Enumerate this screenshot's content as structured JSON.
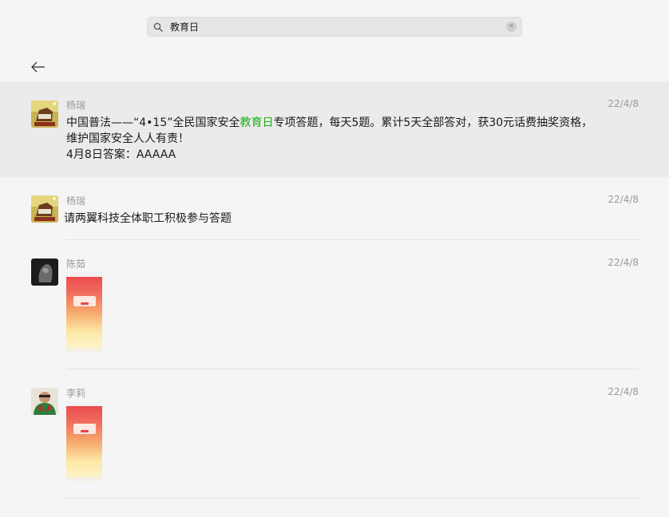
{
  "search": {
    "value": "教育日",
    "icon": "search-icon",
    "clear_icon": "clear-icon"
  },
  "nav": {
    "back_icon": "arrow-left-icon"
  },
  "colors": {
    "highlight": "#1aad19",
    "selected_row": "#ebebeb",
    "background": "#f5f5f5"
  },
  "results": [
    {
      "sender": "杨瑞",
      "date": "22/4/8",
      "text_before": "中国普法——“4•15”全民国家安全",
      "text_highlight": "教育日",
      "text_after": "专项答题，每天5题。累计5天全部答对，获30元话费抽奖资格，维护国家安全人人有责！",
      "line_2": "4月8日答案：AAAAA"
    },
    {
      "sender": "杨瑞",
      "date": "22/4/8",
      "text": "请两翼科技全体职工积极参与答题"
    },
    {
      "sender": "陈茹",
      "date": "22/4/8"
    },
    {
      "sender": "李莉",
      "date": "22/4/8"
    }
  ]
}
